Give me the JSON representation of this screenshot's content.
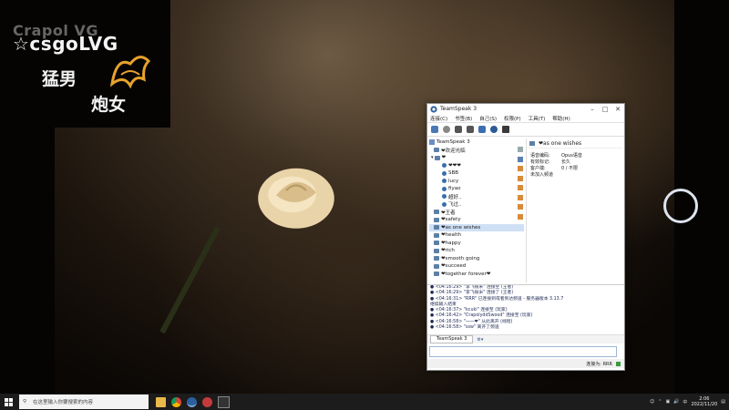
{
  "wallpaper": {
    "logo_ghost": "Crapol VG",
    "logo_main": "☆csgoLVG",
    "logo_line1": "猛男",
    "logo_line2": "炮女"
  },
  "window": {
    "title": "TeamSpeak 3",
    "menu": [
      "连接(C)",
      "书签(B)",
      "自己(S)",
      "权限(P)",
      "工具(T)",
      "帮助(H)"
    ],
    "tree": [
      {
        "label": "TeamSpeak 3",
        "kind": "server"
      },
      {
        "label": "❤欢迎光临",
        "kind": "channel"
      },
      {
        "label": "❤",
        "kind": "channel"
      },
      {
        "label": "❤❤❤",
        "kind": "user"
      },
      {
        "label": "SBB",
        "kind": "user"
      },
      {
        "label": "lucy",
        "kind": "user"
      },
      {
        "label": "fiyao",
        "kind": "user"
      },
      {
        "label": "超好..",
        "kind": "user"
      },
      {
        "label": "飞过..",
        "kind": "user"
      },
      {
        "label": "❤王者",
        "kind": "channel"
      },
      {
        "label": "❤safety",
        "kind": "channel"
      },
      {
        "label": "❤as one wishes",
        "kind": "channel",
        "selected": true
      },
      {
        "label": "❤health",
        "kind": "channel"
      },
      {
        "label": "❤happy",
        "kind": "channel"
      },
      {
        "label": "❤rich",
        "kind": "channel"
      },
      {
        "label": "❤smooth going",
        "kind": "channel"
      },
      {
        "label": "❤succeed",
        "kind": "channel"
      },
      {
        "label": "❤together forever❤",
        "kind": "channel"
      }
    ],
    "info": {
      "header": "❤as one wishes",
      "rows": [
        {
          "k": "语音编码:",
          "v": "Opus语音"
        },
        {
          "k": "有效标记:",
          "v": "长久"
        },
        {
          "k": "客户端:",
          "v": "0 / 不限"
        },
        {
          "k": "未加入频道",
          "v": ""
        }
      ]
    },
    "chat": [
      "● <04:16:29> \"李飞很米\" 连接至 (王者)",
      "● <04:16:29> \"李飞很米\" 连接了 (王者)",
      "● <04:16:31> \"RRR\" 已连接到或者到达频道 - 服务器版本 3.13.7",
      "继续输入结束",
      "● <04:16:37> \"kcuki\" 连接至 (玩家)",
      "● <04:16:42> \"CrapolyddSwood\" 连接至 (玩家)",
      "● <04:16:58> \"一一❤\" 从此离开 (线程)",
      "● <04:16:58> \"ssw\" 离开了频道",
      "● <04:17:05> \"爱字❤\" 离开了 (❤❤)"
    ],
    "chat_tab": "TeamSpeak 3",
    "status_text": "连接为: RRR"
  },
  "taskbar": {
    "search_placeholder": "在这里输入你要搜索的内容",
    "time": "2:06",
    "date": "2022/11/20",
    "lang": "中"
  }
}
